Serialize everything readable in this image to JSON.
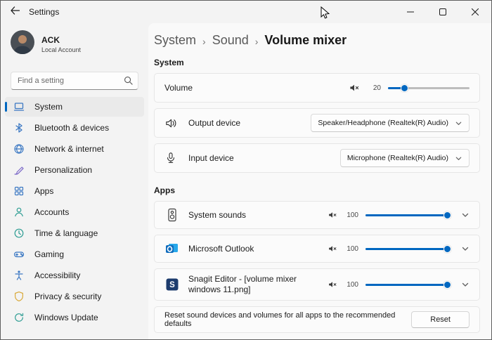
{
  "window": {
    "title": "Settings"
  },
  "sidebar": {
    "user": {
      "name": "ACK",
      "subtitle": "Local Account"
    },
    "search": {
      "placeholder": "Find a setting"
    },
    "items": [
      {
        "label": "System",
        "selected": true
      },
      {
        "label": "Bluetooth & devices"
      },
      {
        "label": "Network & internet"
      },
      {
        "label": "Personalization"
      },
      {
        "label": "Apps"
      },
      {
        "label": "Accounts"
      },
      {
        "label": "Time & language"
      },
      {
        "label": "Gaming"
      },
      {
        "label": "Accessibility"
      },
      {
        "label": "Privacy & security"
      },
      {
        "label": "Windows Update"
      }
    ]
  },
  "breadcrumb": {
    "items": [
      "System",
      "Sound",
      "Volume mixer"
    ],
    "separator": "›"
  },
  "main": {
    "system_section": {
      "title": "System",
      "volume": {
        "label": "Volume",
        "value": 20
      },
      "output": {
        "label": "Output device",
        "value": "Speaker/Headphone (Realtek(R) Audio)"
      },
      "input": {
        "label": "Input device",
        "value": "Microphone (Realtek(R) Audio)"
      }
    },
    "apps_section": {
      "title": "Apps",
      "apps": [
        {
          "name": "System sounds",
          "volume": 100
        },
        {
          "name": "Microsoft Outlook",
          "volume": 100
        },
        {
          "name": "Snagit Editor - [volume mixer windows 11.png]",
          "volume": 100
        }
      ],
      "reset": {
        "text": "Reset sound devices and volumes for all apps to the recommended defaults",
        "button_label": "Reset"
      }
    }
  },
  "colors": {
    "accent": "#0067c0",
    "card_bg": "#fbfbfb",
    "window_bg": "#f3f3f3"
  }
}
